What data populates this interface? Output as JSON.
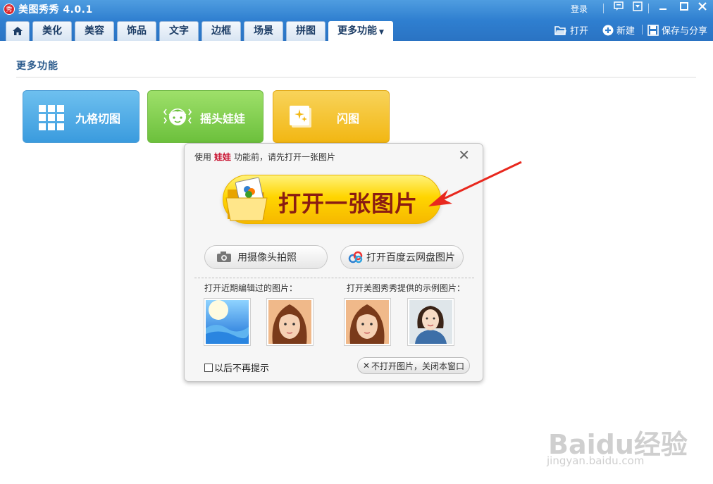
{
  "window": {
    "title": "美图秀秀 4.0.1",
    "logo_text": "秀",
    "login_label": "登录",
    "controls": {
      "msg": "▭",
      "menu": "▾",
      "min": "—",
      "max": "☐",
      "close": "✕"
    }
  },
  "tabs": {
    "home": "⌂",
    "items": [
      "美化",
      "美容",
      "饰品",
      "文字",
      "边框",
      "场景",
      "拼图"
    ],
    "active_label": "更多功能",
    "active_caret": "▼"
  },
  "toolbar": {
    "open_label": "打开",
    "new_label": "新建",
    "save_label": "保存与分享"
  },
  "section": {
    "title": "更多功能"
  },
  "features": {
    "grid_label": "九格切图",
    "doll_label": "摇头娃娃",
    "flash_label": "闪图"
  },
  "dialog": {
    "hint_prefix": "使用",
    "hint_highlight": "娃娃",
    "hint_suffix": "功能前，请先打开一张图片",
    "close_icon": "✕",
    "open_big_label": "打开一张图片",
    "camera_label": "用摄像头拍照",
    "cloud_label": "打开百度云网盘图片",
    "recent_label": "打开近期编辑过的图片：",
    "sample_label": "打开美图秀秀提供的示例图片：",
    "no_remind_label": "以后不再提示",
    "close_window_label": "不打开图片，关闭本窗口",
    "close_window_icon": "✕"
  },
  "watermark": {
    "main": "Baidu经验",
    "sub": "jingyan.baidu.com"
  },
  "colors": {
    "titlebar": "#2f7fd0",
    "accent_red": "#c8102e",
    "grid_button": "#3a9bde",
    "doll_button": "#6cc03c",
    "flash_button": "#f2b713",
    "arrow": "#e8281e"
  }
}
